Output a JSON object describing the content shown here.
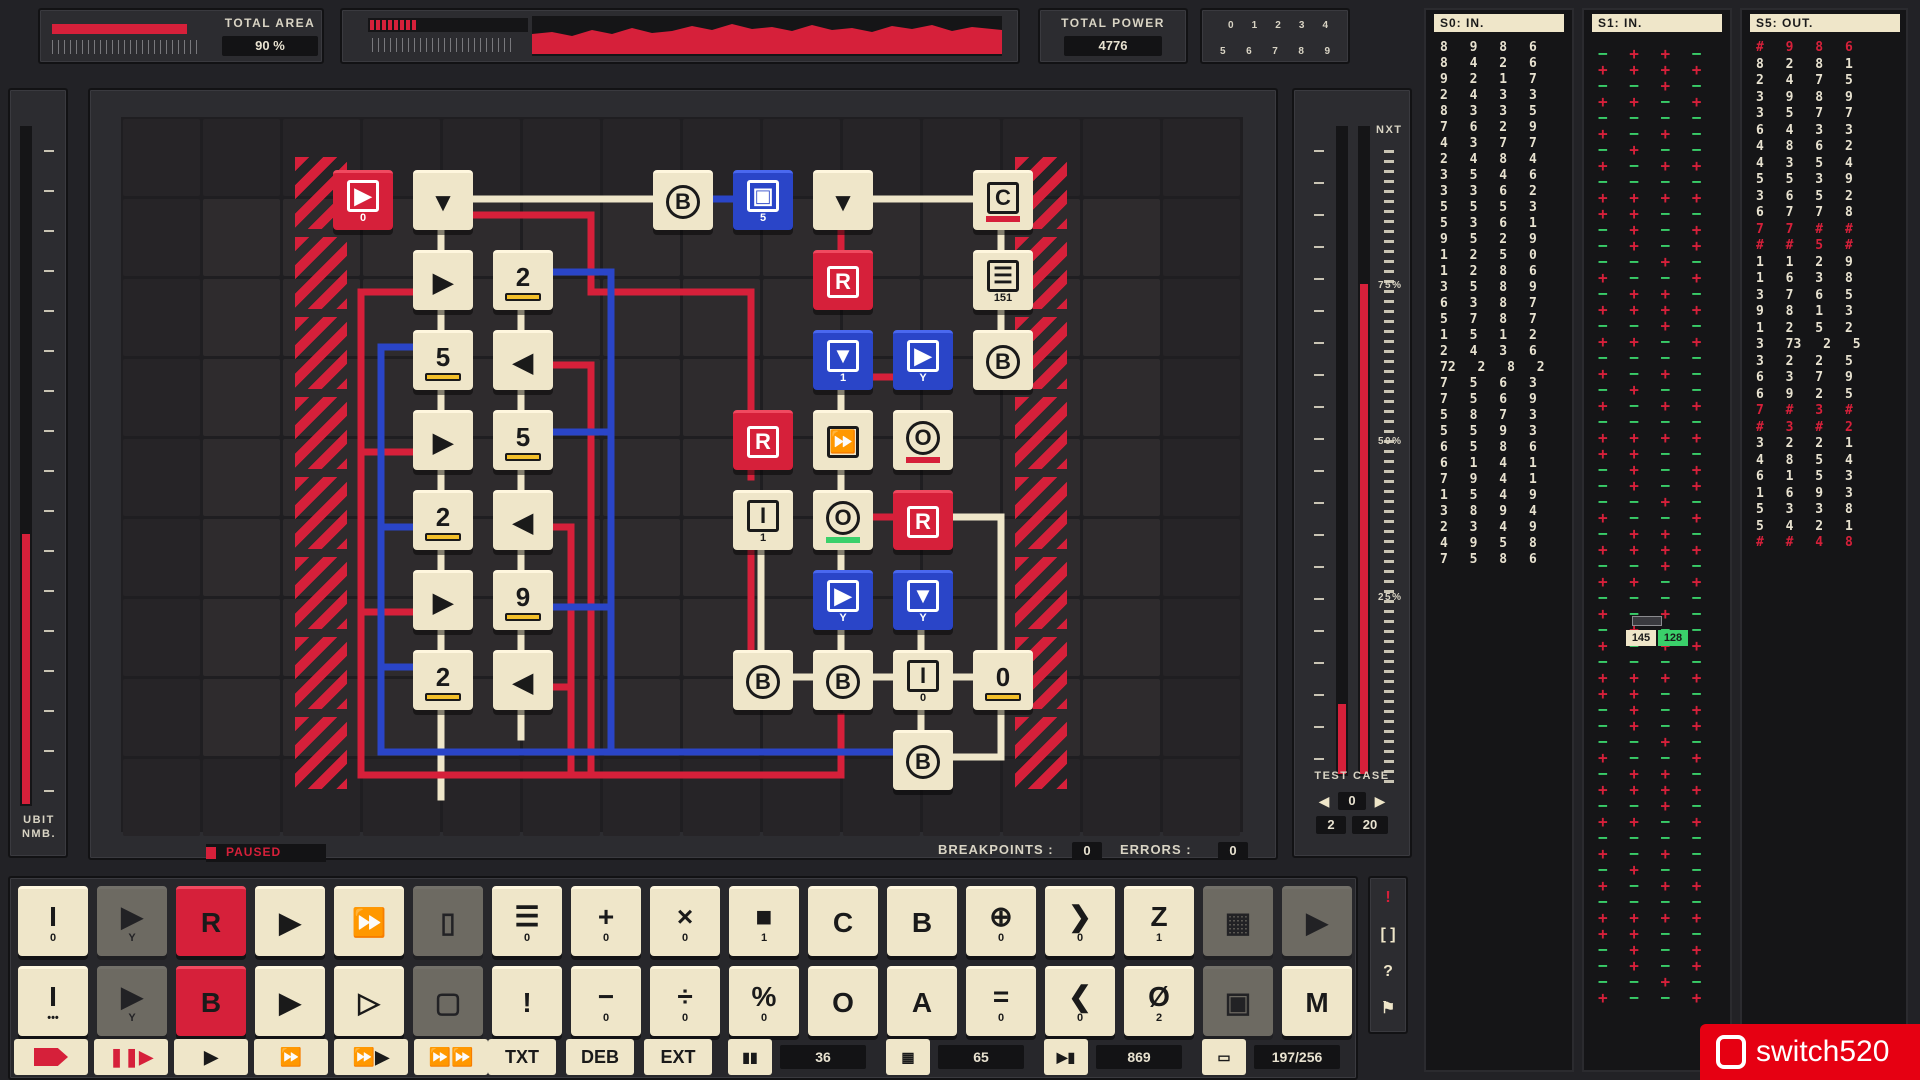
{
  "header": {
    "total_area_label": "TOTAL AREA",
    "total_area_value": "90 %",
    "total_area_fill": 0.9,
    "total_power_label": "TOTAL POWER",
    "total_power_value": "4776",
    "dial_numbers_top": [
      "0",
      "1",
      "2",
      "3",
      "4"
    ],
    "dial_numbers_bottom": [
      "5",
      "6",
      "7",
      "8",
      "9"
    ]
  },
  "left_meter": {
    "label_1": "UBIT",
    "label_2": "NMB."
  },
  "right_meter": {
    "nxt_label": "NXT",
    "scale": [
      "75%",
      "50%",
      "25%"
    ],
    "test_case_label": "TEST CASE",
    "test_case_index": "0",
    "test_case_a": "2",
    "test_case_b": "20"
  },
  "status": {
    "state": "PAUSED",
    "breakpoints_label": "BREAKPOINTS :",
    "breakpoints_value": "0",
    "errors_label": "ERRORS :",
    "errors_value": "0"
  },
  "tiles": [
    {
      "id": "t1",
      "kind": "red",
      "glyph": "▶",
      "frame": "sq",
      "sub": "0",
      "x": 0,
      "y": 0
    },
    {
      "id": "t2",
      "kind": "cream",
      "glyph": "▼",
      "x": 1,
      "y": 0
    },
    {
      "id": "t3",
      "kind": "cream",
      "glyph": "B",
      "frame": "circle",
      "x": 4,
      "y": 0
    },
    {
      "id": "t4",
      "kind": "blue",
      "glyph": "▣",
      "frame": "sq",
      "sub": "5",
      "x": 5,
      "y": 0
    },
    {
      "id": "t5",
      "kind": "cream",
      "glyph": "▼",
      "x": 6,
      "y": 0
    },
    {
      "id": "t6",
      "kind": "cream",
      "glyph": "C",
      "frame": "sq",
      "bar": "red",
      "x": 8,
      "y": 0
    },
    {
      "id": "t7",
      "kind": "cream",
      "glyph": "▶",
      "x": 1,
      "y": 1
    },
    {
      "id": "t8",
      "kind": "cream",
      "glyph": "2",
      "bar": "yellow",
      "x": 2,
      "y": 1
    },
    {
      "id": "t9",
      "kind": "red",
      "glyph": "R",
      "frame": "sq",
      "x": 6,
      "y": 1
    },
    {
      "id": "t10",
      "kind": "cream",
      "glyph": "☰",
      "frame": "sq",
      "sub": "151",
      "x": 8,
      "y": 1
    },
    {
      "id": "t11",
      "kind": "cream",
      "glyph": "5",
      "bar": "yellow",
      "x": 1,
      "y": 2
    },
    {
      "id": "t12",
      "kind": "cream",
      "glyph": "◀",
      "x": 2,
      "y": 2
    },
    {
      "id": "t13",
      "kind": "blue",
      "glyph": "▼",
      "frame": "sq",
      "sub": "1",
      "x": 6,
      "y": 2
    },
    {
      "id": "t14",
      "kind": "blue",
      "glyph": "▶",
      "frame": "sq",
      "sub": "Y",
      "x": 7,
      "y": 2
    },
    {
      "id": "t15",
      "kind": "cream",
      "glyph": "B",
      "frame": "circle",
      "x": 8,
      "y": 2
    },
    {
      "id": "t16",
      "kind": "cream",
      "glyph": "▶",
      "x": 1,
      "y": 3
    },
    {
      "id": "t17",
      "kind": "cream",
      "glyph": "5",
      "bar": "yellow",
      "x": 2,
      "y": 3
    },
    {
      "id": "t18",
      "kind": "red",
      "glyph": "R",
      "frame": "sq",
      "x": 5,
      "y": 3
    },
    {
      "id": "t19",
      "kind": "cream",
      "glyph": "⏩",
      "frame": "sq",
      "x": 6,
      "y": 3
    },
    {
      "id": "t20",
      "kind": "cream",
      "glyph": "O",
      "frame": "circle",
      "bar": "red",
      "x": 7,
      "y": 3
    },
    {
      "id": "t21",
      "kind": "cream",
      "glyph": "2",
      "bar": "yellow",
      "x": 1,
      "y": 4
    },
    {
      "id": "t22",
      "kind": "cream",
      "glyph": "◀",
      "x": 2,
      "y": 4
    },
    {
      "id": "t23",
      "kind": "cream",
      "glyph": "I",
      "frame": "sq",
      "sub": "1",
      "x": 5,
      "y": 4
    },
    {
      "id": "t24",
      "kind": "cream",
      "glyph": "O",
      "frame": "circle",
      "bar": "green",
      "x": 6,
      "y": 4
    },
    {
      "id": "t25",
      "kind": "red",
      "glyph": "R",
      "frame": "sq",
      "x": 7,
      "y": 4
    },
    {
      "id": "t26",
      "kind": "cream",
      "glyph": "▶",
      "x": 1,
      "y": 5
    },
    {
      "id": "t27",
      "kind": "cream",
      "glyph": "9",
      "bar": "yellow",
      "x": 2,
      "y": 5
    },
    {
      "id": "t28",
      "kind": "blue",
      "glyph": "▶",
      "frame": "sq",
      "sub": "Y",
      "x": 6,
      "y": 5
    },
    {
      "id": "t29",
      "kind": "blue",
      "glyph": "▼",
      "frame": "sq",
      "sub": "Y",
      "x": 7,
      "y": 5
    },
    {
      "id": "t30",
      "kind": "cream",
      "glyph": "2",
      "bar": "yellow",
      "x": 1,
      "y": 6
    },
    {
      "id": "t31",
      "kind": "cream",
      "glyph": "◀",
      "x": 2,
      "y": 6
    },
    {
      "id": "t32",
      "kind": "cream",
      "glyph": "B",
      "frame": "circle",
      "x": 5,
      "y": 6
    },
    {
      "id": "t33",
      "kind": "cream",
      "glyph": "B",
      "frame": "circle",
      "x": 6,
      "y": 6
    },
    {
      "id": "t34",
      "kind": "cream",
      "glyph": "I",
      "frame": "sq",
      "sub": "0",
      "x": 7,
      "y": 6
    },
    {
      "id": "t35",
      "kind": "cream",
      "glyph": "0",
      "bar": "yellow",
      "x": 8,
      "y": 6
    },
    {
      "id": "t36",
      "kind": "cream",
      "glyph": "B",
      "frame": "circle",
      "x": 7,
      "y": 7
    }
  ],
  "palette_row1": [
    {
      "glyph": "I",
      "sub": "0",
      "kind": "cream"
    },
    {
      "glyph": "▶",
      "sub": "Y",
      "kind": "cream",
      "dim": true
    },
    {
      "glyph": "R",
      "sub": "",
      "kind": "red"
    },
    {
      "glyph": "▶",
      "sub": "",
      "kind": "cream"
    },
    {
      "glyph": "⏩",
      "sub": "",
      "kind": "cream"
    },
    {
      "glyph": "▯",
      "sub": "",
      "kind": "cream",
      "dim": true
    },
    {
      "glyph": "☰",
      "sub": "0",
      "kind": "cream"
    },
    {
      "glyph": "+",
      "sub": "0",
      "kind": "cream"
    },
    {
      "glyph": "×",
      "sub": "0",
      "kind": "cream"
    },
    {
      "glyph": "■",
      "sub": "1",
      "kind": "cream"
    },
    {
      "glyph": "C",
      "sub": "",
      "kind": "cream"
    },
    {
      "glyph": "B",
      "sub": "",
      "kind": "cream"
    },
    {
      "glyph": "⊕",
      "sub": "0",
      "kind": "cream"
    },
    {
      "glyph": "❯",
      "sub": "0",
      "kind": "cream"
    },
    {
      "glyph": "Z",
      "sub": "1",
      "kind": "cream"
    },
    {
      "glyph": "▦",
      "sub": "",
      "kind": "cream",
      "dim": true
    },
    {
      "glyph": "▶",
      "sub": "",
      "kind": "cream",
      "dim": true
    }
  ],
  "palette_row2": [
    {
      "glyph": "I",
      "sub": "•••",
      "kind": "cream"
    },
    {
      "glyph": "▶",
      "sub": "Y",
      "kind": "cream",
      "dim": true
    },
    {
      "glyph": "B",
      "sub": "",
      "kind": "red"
    },
    {
      "glyph": "▶",
      "sub": "",
      "kind": "cream"
    },
    {
      "glyph": "▷",
      "sub": "",
      "kind": "cream"
    },
    {
      "glyph": "▢",
      "sub": "",
      "kind": "cream",
      "dim": true
    },
    {
      "glyph": "!",
      "sub": "",
      "kind": "cream"
    },
    {
      "glyph": "−",
      "sub": "0",
      "kind": "cream"
    },
    {
      "glyph": "÷",
      "sub": "0",
      "kind": "cream"
    },
    {
      "glyph": "%",
      "sub": "0",
      "kind": "cream"
    },
    {
      "glyph": "O",
      "sub": "",
      "kind": "cream"
    },
    {
      "glyph": "A",
      "sub": "",
      "kind": "cream"
    },
    {
      "glyph": "=",
      "sub": "0",
      "kind": "cream"
    },
    {
      "glyph": "❮",
      "sub": "0",
      "kind": "cream"
    },
    {
      "glyph": "Ø",
      "sub": "2",
      "kind": "cream"
    },
    {
      "glyph": "▣",
      "sub": "",
      "kind": "cream",
      "dim": true
    },
    {
      "glyph": "M",
      "sub": "",
      "kind": "cream"
    }
  ],
  "side_tools": [
    "!",
    "[ ]",
    "?",
    "⚑"
  ],
  "bottom": {
    "txt": "TXT",
    "deb": "DEB",
    "ext": "EXT",
    "v1": "36",
    "v2": "65",
    "v3": "869",
    "v4": "197/256"
  },
  "columns": {
    "s0_title": "S0: IN.",
    "s1_title": "S1: IN.",
    "s5_title": "S5: OUT.",
    "s0_rows": [
      "8 9 8 6",
      "8 4 2 6",
      "9 2 1 7",
      "2 4 3 3",
      "8 3 3 5",
      "7 6 2 9",
      "4 3 7 7",
      "2 4 8 4",
      "3 5 4 6",
      "3 3 6 2",
      "5 5 5 3",
      "5 3 6 1",
      "9 5 2 9",
      "1 2 5 0",
      "1 2 8 6",
      "3 5 8 9",
      "6 3 8 7",
      "5 7 8 7",
      "1 5 1 2",
      "2 4 3 6",
      "72 2 8 2",
      "7 5 6 3",
      "7 5 6 9",
      "5 8 7 3",
      "5 5 9 3",
      "6 5 8 6",
      "6 1 4 1",
      "7 9 4 1",
      "1 5 4 9",
      "3 8 9 4",
      "2 3 4 9",
      "4 9 5 8",
      "7 5 8 6"
    ],
    "s1_signs": [
      "− + + −",
      "+ + + +",
      "− − + −",
      "+ + − +",
      "− − − −",
      "+ − + −",
      "− + − −",
      "+ − + +",
      "− − − −",
      "+ + + +",
      "+ + − −",
      "− + − +",
      "− + − +",
      "− − + −",
      "+ − − +"
    ],
    "s1_marker_a": "145",
    "s1_marker_b": "128",
    "s5_rows": [
      "# 9 8 6",
      "8 2 8 1",
      "2 4 7 5",
      "3 9 8 9",
      "3 5 7 7",
      "6 4 3 3",
      "4 8 6 2",
      "4 3 5 4",
      "5 5 3 9",
      "3 6 5 2",
      "6 7 7 8",
      "7 7 # #",
      "# # 5 #",
      "1 1 2 9",
      "1 6 3 8",
      "3 7 6 5",
      "9 8 1 3",
      "1 2 5 2",
      "3 73 2 5",
      "3 2 2 5",
      "6 3 7 9",
      "6 9 2 5",
      "7 # 3 #",
      "# 3 # 2",
      "3 2 2 1",
      "4 8 5 4",
      "6 1 5 3",
      "1 6 9 3",
      "5 3 3 8",
      "5 4 2 1",
      "# # 4 8"
    ]
  },
  "logo": {
    "text": "switch520"
  },
  "colors": {
    "red": "#d6203a",
    "blue": "#2a45c8",
    "cream": "#efe6c9",
    "yellow": "#f2bf2a",
    "green": "#3ad06a",
    "bg": "#222226"
  }
}
